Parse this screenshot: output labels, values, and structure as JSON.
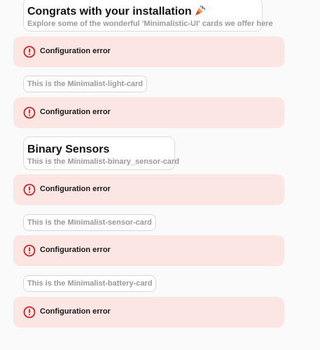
{
  "welcome_card": {
    "title": "Congrats with your installation",
    "title_icon": "party-popper-icon",
    "subtitle": "Explore some of the wonderful 'Minimalistic-UI' cards we offer here"
  },
  "error_label": "Configuration error",
  "error_icon": "alert-circle-icon",
  "colors": {
    "error_bg": "#fbe6e3",
    "error_icon": "#c62828",
    "page_bg": "#fafafa"
  },
  "light_chip": "This is the Minimalist-light-card",
  "binary_card": {
    "title": "Binary Sensors",
    "subtitle": "This is the Minimalist-binary_sensor-card"
  },
  "sensor_chip": "This is the Minimalist-sensor-card",
  "battery_chip": "This is the Minimalist-battery-card"
}
